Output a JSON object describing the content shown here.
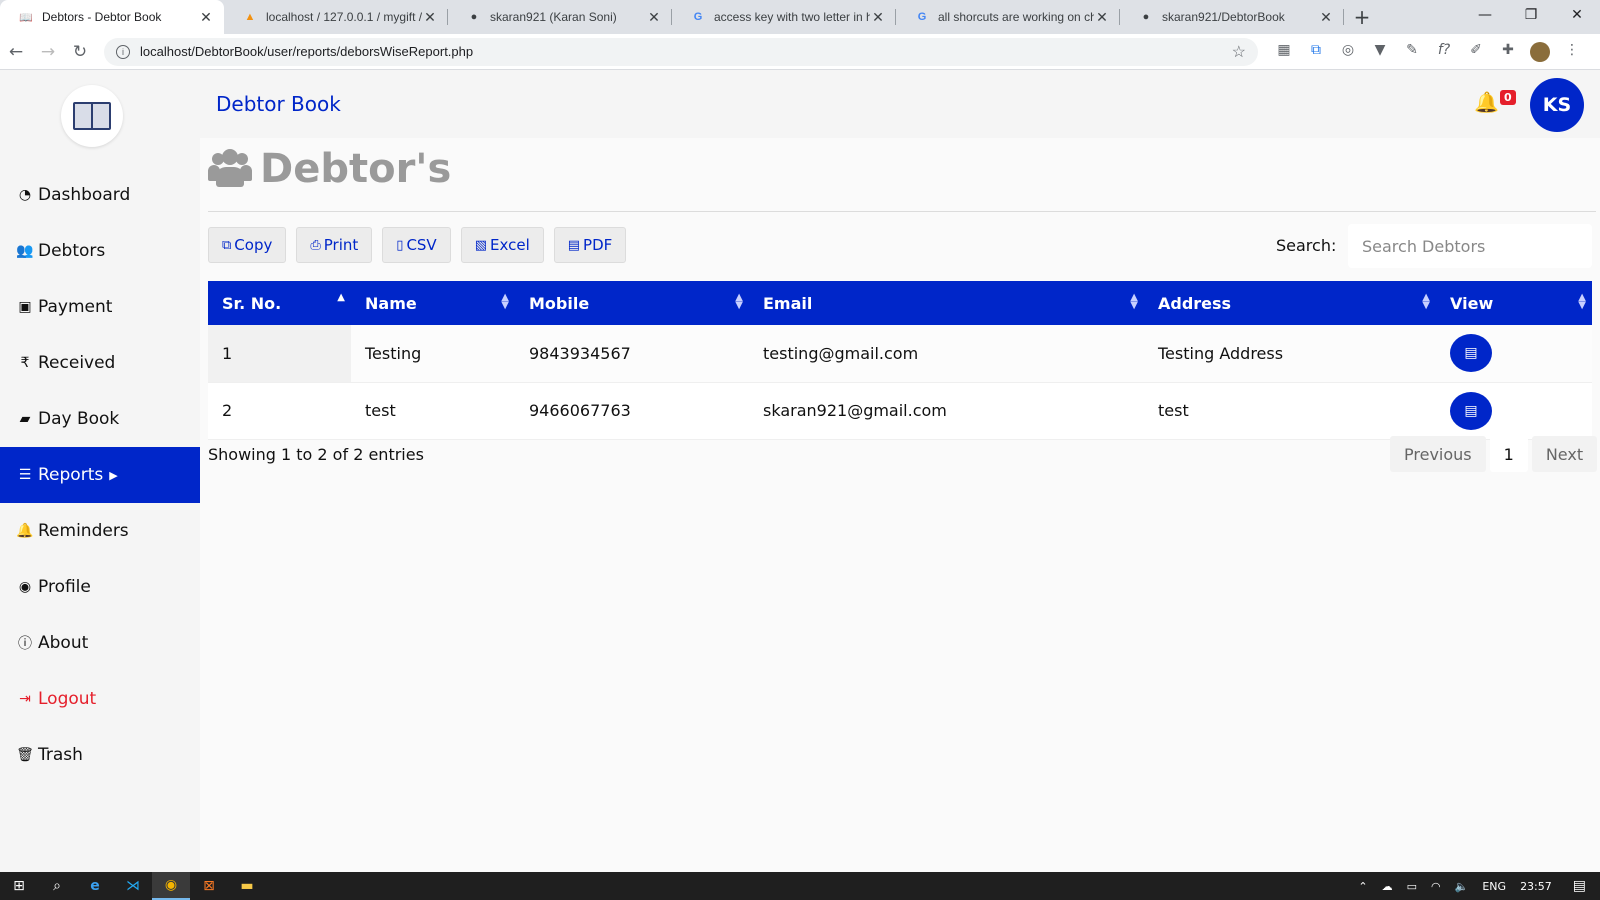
{
  "browser": {
    "tabs": [
      {
        "title": "Debtors - Debtor Book",
        "icon": "book-favicon",
        "active": true
      },
      {
        "title": "localhost / 127.0.0.1 / mygift / ",
        "icon": "phpmyadmin-favicon",
        "active": false
      },
      {
        "title": "skaran921 (Karan Soni)",
        "icon": "github-favicon",
        "active": false
      },
      {
        "title": "access key with two letter in ht",
        "icon": "google-favicon",
        "active": false
      },
      {
        "title": "all shorcuts are working on chr",
        "icon": "google-favicon",
        "active": false
      },
      {
        "title": "skaran921/DebtorBook",
        "icon": "github-favicon",
        "active": false
      }
    ],
    "url": "localhost/DebtorBook/user/reports/deborsWiseReport.php"
  },
  "app": {
    "brand": "Debtor Book",
    "notification_count": "0",
    "user_initials": "KS",
    "accent_color": "#0026c9",
    "sidebar": [
      {
        "label": "Dashboard",
        "icon": "tachometer-icon"
      },
      {
        "label": "Debtors",
        "icon": "users-icon"
      },
      {
        "label": "Payment",
        "icon": "money-icon"
      },
      {
        "label": "Received",
        "icon": "rupee-icon"
      },
      {
        "label": "Day Book",
        "icon": "book-icon"
      },
      {
        "label": "Reports",
        "icon": "list-alt-icon",
        "active": true
      },
      {
        "label": "Reminders",
        "icon": "bell-icon"
      },
      {
        "label": "Profile",
        "icon": "user-circle-icon"
      },
      {
        "label": "About",
        "icon": "info-circle-icon"
      },
      {
        "label": "Logout",
        "icon": "sign-out-icon"
      },
      {
        "label": "Trash",
        "icon": "trash-icon"
      }
    ]
  },
  "page": {
    "title": "Debtor's",
    "export_buttons": [
      "Copy",
      "Print",
      "CSV",
      "Excel",
      "PDF"
    ],
    "search_label": "Search:",
    "search_placeholder": "Search Debtors",
    "table": {
      "headers": [
        "Sr. No.",
        "Name",
        "Mobile",
        "Email",
        "Address",
        "View"
      ],
      "rows": [
        [
          "1",
          "Testing",
          "9843934567",
          "testing@gmail.com",
          "Testing Address"
        ],
        [
          "2",
          "test",
          "9466067763",
          "skaran921@gmail.com",
          "test"
        ]
      ]
    },
    "info": "Showing 1 to 2 of 2 entries",
    "pager": {
      "previous": "Previous",
      "current": "1",
      "next": "Next"
    }
  },
  "taskbar": {
    "lang": "ENG",
    "time": "23:57"
  }
}
